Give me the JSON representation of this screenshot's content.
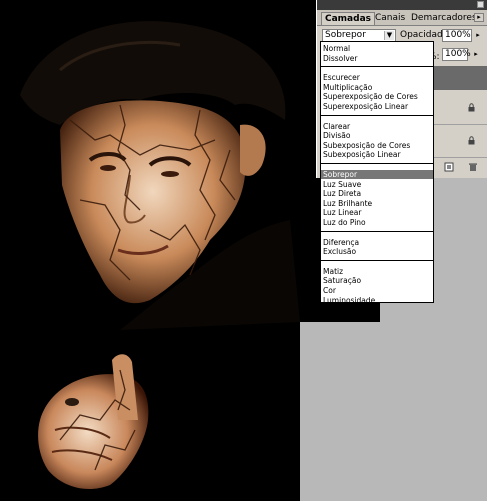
{
  "palette": {
    "tabs": [
      {
        "label": "Camadas",
        "active": true
      },
      {
        "label": "Canais",
        "active": false
      },
      {
        "label": "Demarcadores",
        "active": false
      }
    ],
    "blend_mode_value": "Sobrepor",
    "opacity_label": "Opacidade:",
    "opacity_value": "100%",
    "fill_label": "%:",
    "fill_value": "100%"
  },
  "blend_menu": {
    "groups": [
      [
        "Normal",
        "Dissolver"
      ],
      [
        "Escurecer",
        "Multiplicação",
        "Superexposição de Cores",
        "Superexposição Linear"
      ],
      [
        "Clarear",
        "Divisão",
        "Subexposição de Cores",
        "Subexposição Linear"
      ],
      [
        "Sobrepor",
        "Luz Suave",
        "Luz Direta",
        "Luz Brilhante",
        "Luz Linear",
        "Luz do Pino"
      ],
      [
        "Diferença",
        "Exclusão"
      ],
      [
        "Matiz",
        "Saturação",
        "Cor",
        "Luminosidade"
      ]
    ],
    "selected": "Sobrepor"
  },
  "colors": {
    "panel_bg": "#d4d0c8",
    "highlight": "#777777",
    "canvas_bg": "#000000"
  },
  "icons": [
    "close-icon",
    "palette-menu-icon",
    "dropdown-arrow-icon",
    "lock-icon",
    "new-layer-icon",
    "trash-icon"
  ]
}
